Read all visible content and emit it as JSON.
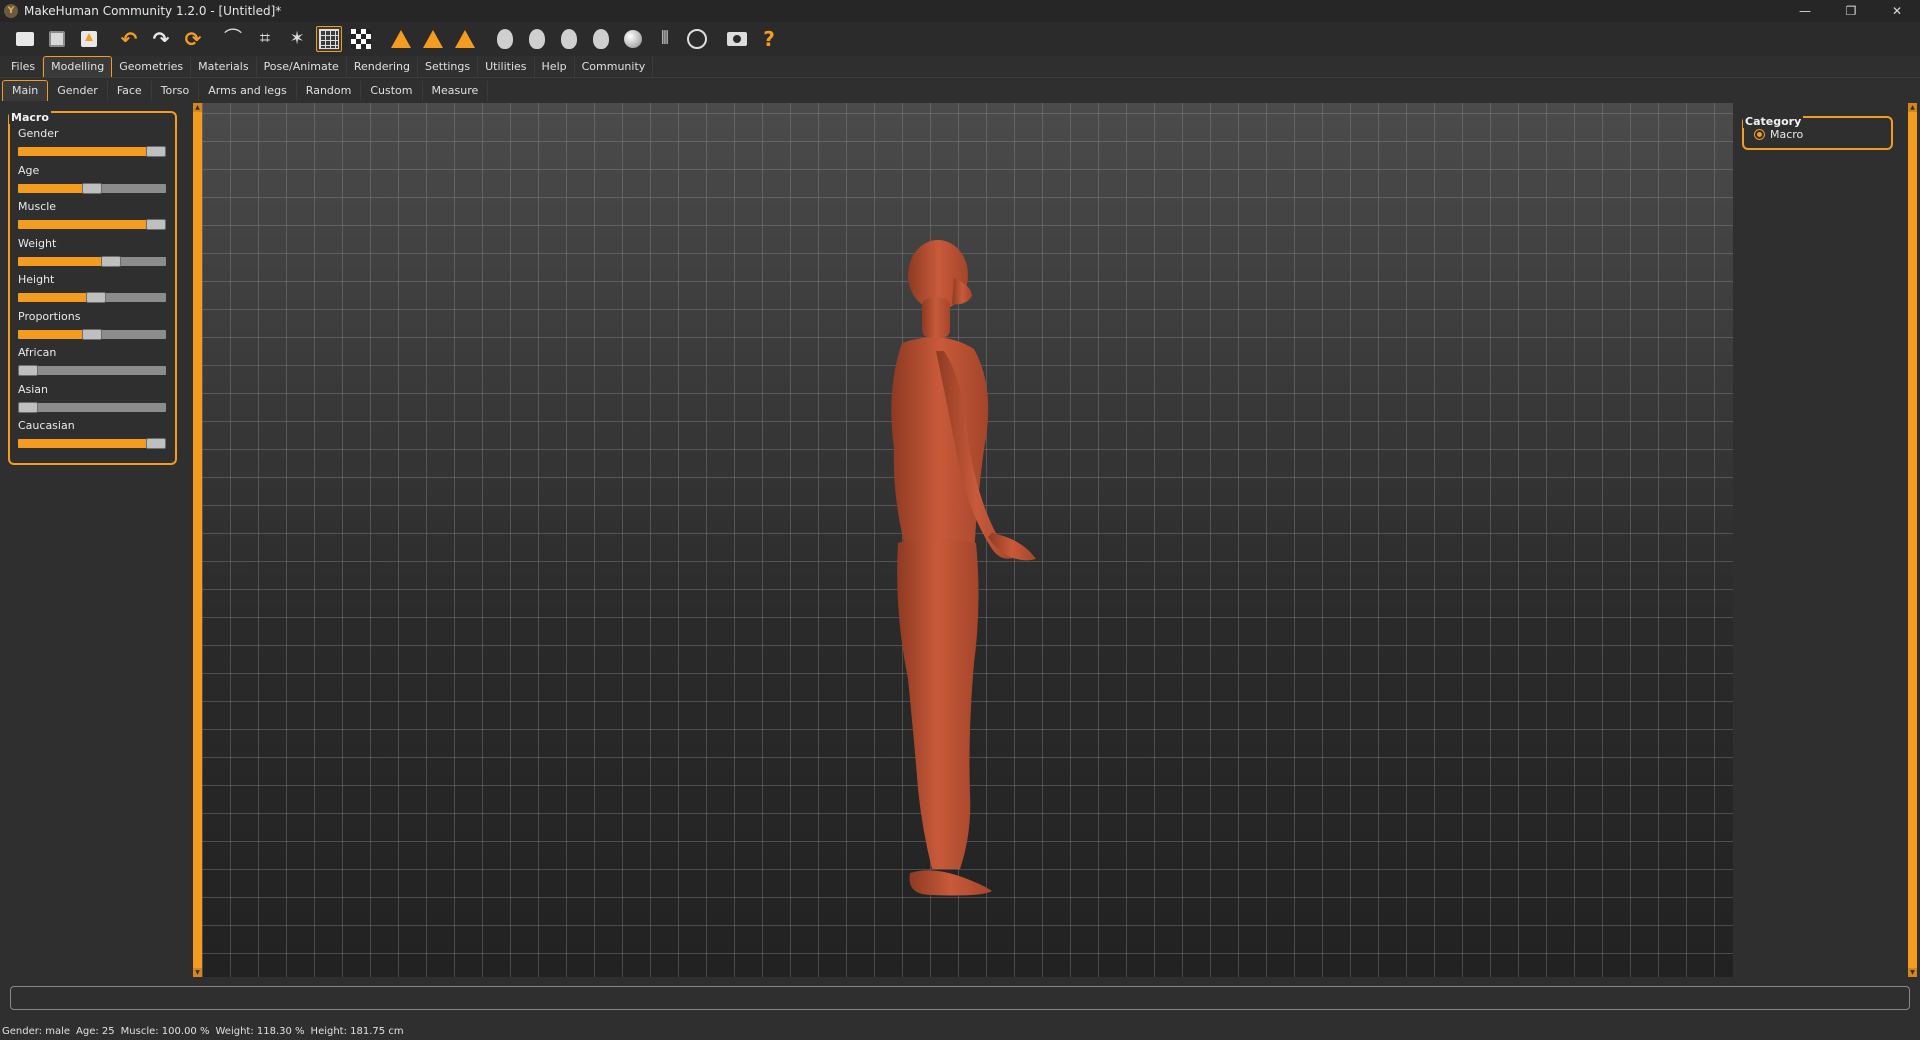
{
  "window": {
    "title": "MakeHuman Community 1.2.0 - [Untitled]*",
    "controls": {
      "minimize": "—",
      "maximize": "❐",
      "close": "✕"
    }
  },
  "toolbar": {
    "icons": [
      "new-file-icon",
      "save-icon",
      "export-icon",
      "undo-icon",
      "redo-icon",
      "reset-icon",
      "smooth-icon",
      "wireframe-icon",
      "pose-icon",
      "grid-icon",
      "background-icon",
      "symmetry-left-icon",
      "symmetry-right-icon",
      "symmetry-icon",
      "front-view-icon",
      "back-view-icon",
      "left-view-icon",
      "right-view-icon",
      "top-view-icon",
      "bottom-view-icon",
      "reset-camera-icon",
      "screenshot-icon",
      "help-icon"
    ]
  },
  "main_tabs": [
    "Files",
    "Modelling",
    "Geometries",
    "Materials",
    "Pose/Animate",
    "Rendering",
    "Settings",
    "Utilities",
    "Help",
    "Community"
  ],
  "main_tab_active": "Modelling",
  "sub_tabs": [
    "Main",
    "Gender",
    "Face",
    "Torso",
    "Arms and legs",
    "Random",
    "Custom",
    "Measure"
  ],
  "sub_tab_active": "Main",
  "left_panel": {
    "title": "Macro",
    "sliders": [
      {
        "label": "Gender",
        "value": 1.0
      },
      {
        "label": "Age",
        "value": 0.5
      },
      {
        "label": "Muscle",
        "value": 1.0
      },
      {
        "label": "Weight",
        "value": 0.65
      },
      {
        "label": "Height",
        "value": 0.53
      },
      {
        "label": "Proportions",
        "value": 0.5
      },
      {
        "label": "African",
        "value": 0.0
      },
      {
        "label": "Asian",
        "value": 0.0
      },
      {
        "label": "Caucasian",
        "value": 1.0
      }
    ]
  },
  "right_panel": {
    "title": "Category",
    "radio_label": "Macro"
  },
  "status": {
    "gender": "Gender: male",
    "age": "Age: 25",
    "muscle": "Muscle: 100.00 %",
    "weight": "Weight: 118.30 %",
    "height": "Height: 181.75 cm"
  },
  "colors": {
    "accent": "#f39c1f",
    "background": "#2f2f2f",
    "skin": "#c55a3c"
  }
}
